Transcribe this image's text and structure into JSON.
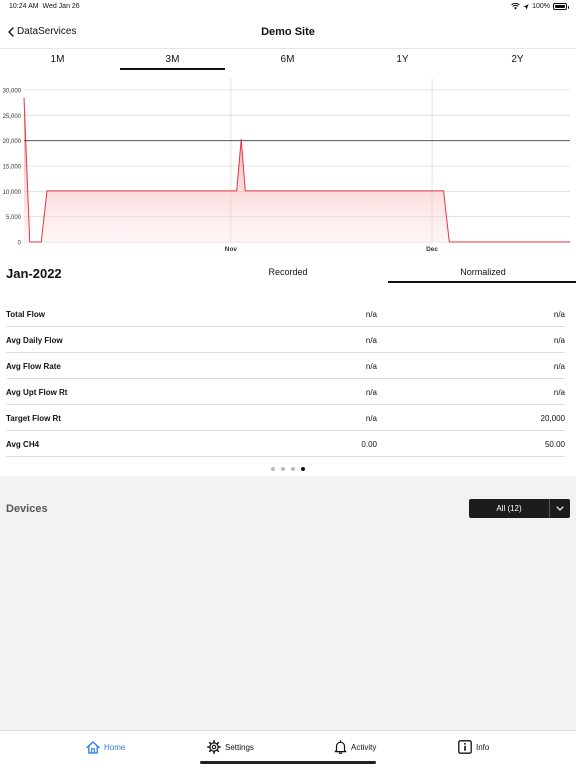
{
  "status_bar": {
    "time": "10:24 AM",
    "date": "Wed Jan 26",
    "battery": "100%"
  },
  "nav": {
    "back_label": "DataServices",
    "title": "Demo Site"
  },
  "range_tabs": [
    {
      "label": "1M",
      "active": false
    },
    {
      "label": "3M",
      "active": true
    },
    {
      "label": "6M",
      "active": false
    },
    {
      "label": "1Y",
      "active": false
    },
    {
      "label": "2Y",
      "active": false
    }
  ],
  "chart_data": {
    "type": "area",
    "title": "",
    "xlabel": "",
    "ylabel": "",
    "ylim": [
      0,
      30000
    ],
    "yticks": [
      0,
      5000,
      10000,
      15000,
      20000,
      25000,
      30000
    ],
    "ytick_labels": [
      "0",
      "5,000",
      "10,000",
      "15,000",
      "20,000",
      "25,000",
      "30,000"
    ],
    "xlim": [
      0,
      95
    ],
    "xtick_labels": [
      {
        "x": 36,
        "label": "Nov"
      },
      {
        "x": 71,
        "label": "Dec"
      }
    ],
    "target_line": 20000,
    "grid": true,
    "series": [
      {
        "color": "#e8343f",
        "x": [
          0,
          1,
          3,
          4,
          36,
          37,
          37.8,
          38.5,
          73,
          74,
          95
        ],
        "y": [
          28500,
          0,
          0,
          10100,
          10100,
          10100,
          20300,
          10100,
          10100,
          0,
          0
        ]
      }
    ]
  },
  "summary": {
    "period": "Jan-2022",
    "tabs": [
      {
        "label": "Recorded",
        "active": false
      },
      {
        "label": "Normalized",
        "active": true
      }
    ],
    "rows": [
      {
        "label": "Total Flow",
        "recorded": "n/a",
        "normalized": "n/a"
      },
      {
        "label": "Avg Daily Flow",
        "recorded": "n/a",
        "normalized": "n/a"
      },
      {
        "label": "Avg Flow Rate",
        "recorded": "n/a",
        "normalized": "n/a"
      },
      {
        "label": "Avg Upt Flow Rt",
        "recorded": "n/a",
        "normalized": "n/a"
      },
      {
        "label": "Target Flow Rt",
        "recorded": "n/a",
        "normalized": "20,000"
      },
      {
        "label": "Avg CH4",
        "recorded": "0.00",
        "normalized": "50.00"
      }
    ],
    "pager": {
      "count": 4,
      "active": 3
    }
  },
  "devices": {
    "title": "Devices",
    "filter_value": "All (12)"
  },
  "tab_bar": [
    {
      "label": "Home",
      "icon": "home-icon",
      "active": true
    },
    {
      "label": "Settings",
      "icon": "gear-icon",
      "active": false
    },
    {
      "label": "Activity",
      "icon": "bell-icon",
      "active": false
    },
    {
      "label": "Info",
      "icon": "info-icon",
      "active": false
    }
  ],
  "colors": {
    "accent": "#2a7ae2",
    "series": "#e8343f",
    "dark": "#1c1c1c"
  }
}
